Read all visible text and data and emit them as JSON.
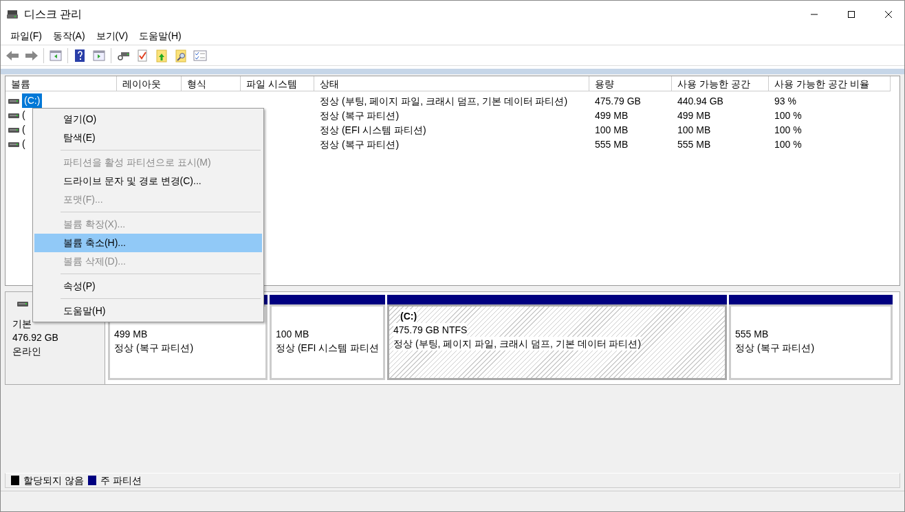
{
  "window": {
    "title": "디스크 관리"
  },
  "menu_bar": [
    "파일(F)",
    "동작(A)",
    "보기(V)",
    "도움말(H)"
  ],
  "table": {
    "columns": [
      "볼륨",
      "레이아웃",
      "형식",
      "파일 시스템",
      "상태",
      "용량",
      "사용 가능한 공간",
      "사용 가능한 공간 비율"
    ],
    "rows": [
      {
        "selected": true,
        "cells": [
          "(C:)",
          "",
          "",
          "",
          "정상 (부팅, 페이지 파일, 크래시 덤프, 기본 데이터 파티션)",
          "475.79 GB",
          "440.94 GB",
          "93 %"
        ]
      },
      {
        "selected": false,
        "cells": [
          "(",
          "",
          "",
          "",
          "정상 (복구 파티션)",
          "499 MB",
          "499 MB",
          "100 %"
        ]
      },
      {
        "selected": false,
        "cells": [
          "(",
          "",
          "",
          "",
          "정상 (EFI 시스템 파티션)",
          "100 MB",
          "100 MB",
          "100 %"
        ]
      },
      {
        "selected": false,
        "cells": [
          "(",
          "",
          "",
          "",
          "정상 (복구 파티션)",
          "555 MB",
          "555 MB",
          "100 %"
        ]
      }
    ]
  },
  "disk": {
    "type": "기본",
    "size": "476.92 GB",
    "state": "온라인",
    "partitions": [
      {
        "selected": false,
        "size": "499 MB",
        "status": "정상 (복구 파티션)"
      },
      {
        "selected": false,
        "size": "100 MB",
        "status": "정상 (EFI 시스템 파티션"
      },
      {
        "selected": true,
        "name": "(C:)",
        "size": "475.79 GB NTFS",
        "status": "정상 (부팅, 페이지 파일, 크래시 덤프, 기본 데이터 파티션)"
      },
      {
        "selected": false,
        "size": "555 MB",
        "status": "정상 (복구 파티션)"
      }
    ]
  },
  "context_menu": [
    [
      {
        "label": "열기(O)",
        "disabled": false,
        "selected": false
      },
      {
        "label": "탐색(E)",
        "disabled": false,
        "selected": false
      }
    ],
    [
      {
        "label": "파티션을 활성 파티션으로 표시(M)",
        "disabled": true,
        "selected": false
      },
      {
        "label": "드라이브 문자 및 경로 변경(C)...",
        "disabled": false,
        "selected": false
      },
      {
        "label": "포맷(F)...",
        "disabled": true,
        "selected": false
      }
    ],
    [
      {
        "label": "볼륨 확장(X)...",
        "disabled": true,
        "selected": false
      },
      {
        "label": "볼륨 축소(H)...",
        "disabled": false,
        "selected": true
      },
      {
        "label": "볼륨 삭제(D)...",
        "disabled": true,
        "selected": false
      }
    ],
    [
      {
        "label": "속성(P)",
        "disabled": false,
        "selected": false
      }
    ],
    [
      {
        "label": "도움말(H)",
        "disabled": false,
        "selected": false
      }
    ]
  ],
  "legend": [
    {
      "label": "할당되지 않음",
      "color": "#000000"
    },
    {
      "label": "주 파티션",
      "color": "#000080"
    }
  ]
}
